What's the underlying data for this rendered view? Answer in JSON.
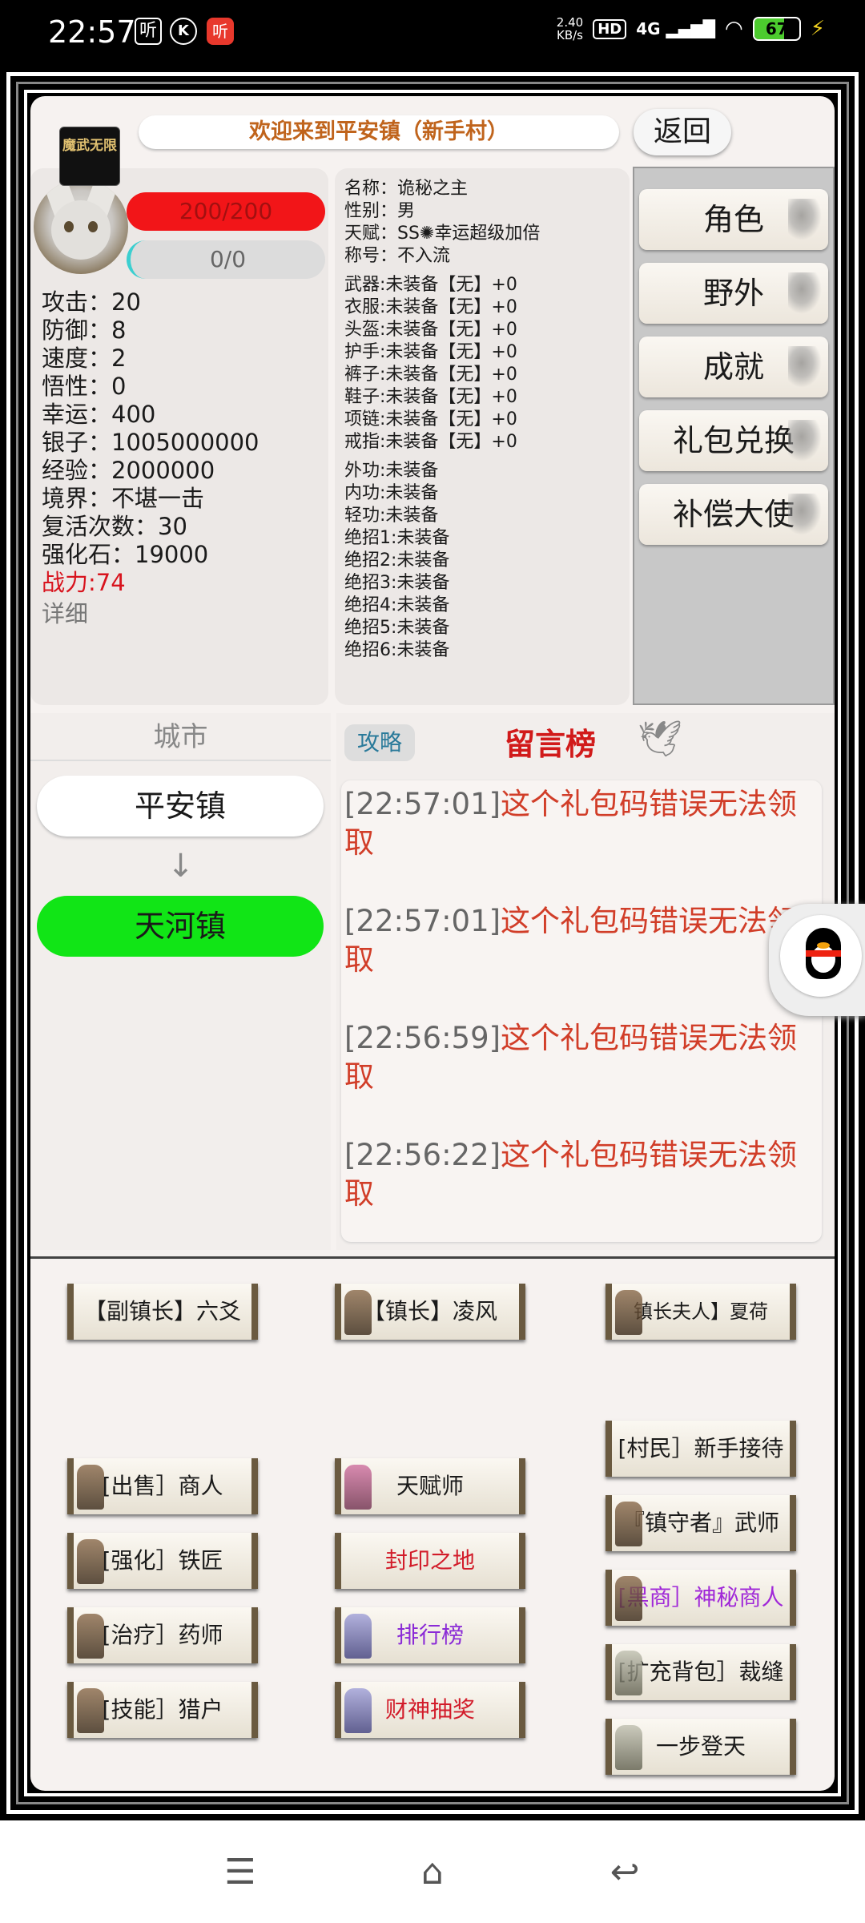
{
  "status_bar": {
    "time": "22:57",
    "icon1": "听",
    "icon2": "K",
    "icon3": "听",
    "net_speed_value": "2.40",
    "net_speed_unit": "KB/s",
    "hd": "HD",
    "signal": "4G",
    "battery": "67",
    "battery_level": 0.67
  },
  "header": {
    "welcome": "欢迎来到平安镇（新手村）",
    "back": "返回",
    "logo": "魔武无限"
  },
  "player": {
    "hp": "200/200",
    "mp": "0/0",
    "stats": [
      "攻击：20",
      "防御：8",
      "速度：2",
      "悟性：0",
      "幸运：400",
      "银子：1005000000",
      "经验：2000000",
      "境界：不堪一击",
      "复活次数：30",
      "强化石：19000"
    ],
    "power": "战力:74",
    "detail": "详细"
  },
  "info": {
    "basic": [
      "名称：诡秘之主",
      "性别：男",
      "天赋：SS✺幸运超级加倍",
      "称号：不入流"
    ],
    "equip": [
      "武器:未装备【无】+0",
      "衣服:未装备【无】+0",
      "头盔:未装备【无】+0",
      "护手:未装备【无】+0",
      "裤子:未装备【无】+0",
      "鞋子:未装备【无】+0",
      "项链:未装备【无】+0",
      "戒指:未装备【无】+0"
    ],
    "skills": [
      "外功:未装备",
      "内功:未装备",
      "轻功:未装备",
      "绝招1:未装备",
      "绝招2:未装备",
      "绝招3:未装备",
      "绝招4:未装备",
      "绝招5:未装备",
      "绝招6:未装备"
    ]
  },
  "nav": [
    "角色",
    "野外",
    "成就",
    "礼包兑换",
    "补偿大使"
  ],
  "city": {
    "title": "城市",
    "current": "平安镇",
    "arrow": "↓",
    "next": "天河镇"
  },
  "board": {
    "guide": "攻略",
    "title": "留言榜",
    "messages": [
      {
        "time": "[22:57:01]",
        "text": "这个礼包码错误无法领取"
      },
      {
        "time": "[22:57:01]",
        "text": "这个礼包码错误无法领取"
      },
      {
        "time": "[22:56:59]",
        "text": "这个礼包码错误无法领取"
      },
      {
        "time": "[22:56:22]",
        "text": "这个礼包码错误无法领取"
      }
    ]
  },
  "npcs": {
    "col1": [
      "【副镇长】六爻",
      "[出售］商人",
      "[强化］铁匠",
      "[治疗］药师",
      "[技能］猎户"
    ],
    "col2": [
      "【镇长】凌风",
      "天赋师",
      "封印之地",
      "排行榜",
      "财神抽奖"
    ],
    "col3": [
      "镇长夫人】夏荷",
      "[村民］新手接待",
      "『镇守者』武师",
      "[黑商］神秘商人",
      "[扩充背包］裁缝",
      "一步登天"
    ]
  },
  "colors": {
    "hp": "#f21518",
    "next_city": "#11e516",
    "message": "#d13d28",
    "power": "#d8141e"
  }
}
